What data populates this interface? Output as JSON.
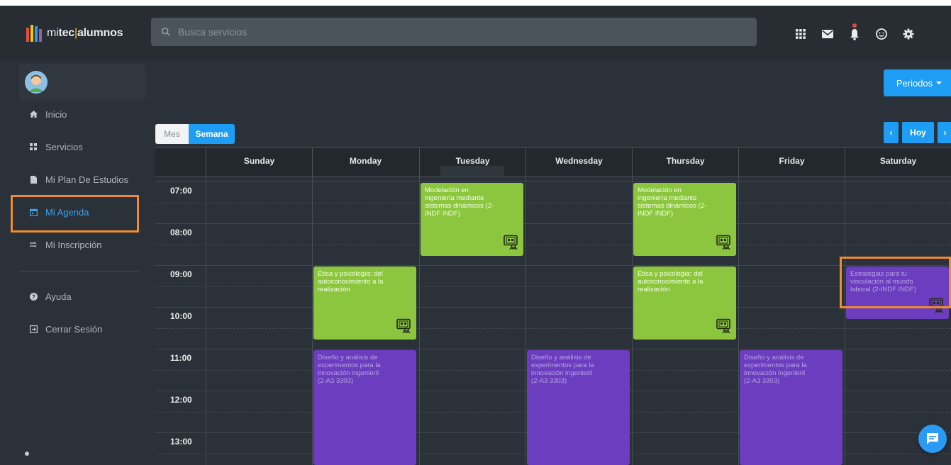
{
  "app": {
    "logo": {
      "prefix": "mi",
      "brand": "tec",
      "separator": "|",
      "suffix": "alumnos",
      "bar_colors": [
        "#e74c3c",
        "#f1c40f",
        "#3498db",
        "#9b59b6"
      ]
    },
    "search": {
      "placeholder": "Busca servicios",
      "value": ""
    },
    "top_icons": [
      "apps-grid-icon",
      "mail-icon",
      "bell-icon",
      "smiley-icon",
      "gear-icon"
    ]
  },
  "sidebar": {
    "items": [
      {
        "label": "Inicio",
        "icon": "home-icon"
      },
      {
        "label": "Servicios",
        "icon": "grid-icon"
      },
      {
        "label": "Mi Plan De Estudios",
        "icon": "document-icon"
      },
      {
        "label": "Mi Agenda",
        "icon": "calendar-icon",
        "active": true
      },
      {
        "label": "Mi Inscripción",
        "icon": "transfer-icon"
      }
    ],
    "footer_items": [
      {
        "label": "Ayuda",
        "icon": "help-icon"
      },
      {
        "label": "Cerrar Sesión",
        "icon": "logout-icon"
      }
    ]
  },
  "toolbar": {
    "periods_label": "Periodos",
    "views": {
      "month": "Mes",
      "week": "Semana",
      "selected": "week"
    },
    "nav": {
      "prev": "‹",
      "today": "Hoy",
      "next": "›"
    }
  },
  "calendar": {
    "days": [
      "Sunday",
      "Monday",
      "Tuesday",
      "Wednesday",
      "Thursday",
      "Friday",
      "Saturday"
    ],
    "times": [
      "07:00",
      "08:00",
      "09:00",
      "10:00",
      "11:00",
      "12:00",
      "13:00"
    ],
    "events": [
      {
        "day": "Tuesday",
        "start": "07:00",
        "end": "08:45",
        "color": "green",
        "title": "Modelación en ingeniería mediante sistemas dinámicos (2-INDF INDF)",
        "icon": "virtual-class-icon"
      },
      {
        "day": "Thursday",
        "start": "07:00",
        "end": "08:45",
        "color": "green",
        "title": "Modelación en ingeniería mediante sistemas dinámicos (2-INDF INDF)",
        "icon": "virtual-class-icon"
      },
      {
        "day": "Monday",
        "start": "09:00",
        "end": "10:45",
        "color": "green",
        "title": "Ética y psicología: del autoconocimiento a la realización",
        "icon": "virtual-class-icon"
      },
      {
        "day": "Thursday",
        "start": "09:00",
        "end": "10:45",
        "color": "green",
        "title": "Ética y psicología: del autoconocimiento a la realización",
        "icon": "virtual-class-icon"
      },
      {
        "day": "Saturday",
        "start": "09:00",
        "end": "10:15",
        "color": "purple",
        "title": "Estrategias para tu vinculación al mundo laboral (2-INDF INDF)",
        "icon": "virtual-class-icon"
      },
      {
        "day": "Monday",
        "start": "11:00",
        "end": "13:45",
        "color": "purple",
        "title": "Diseño y análisis de experimentos para la innovación ingenieril (2-A3 3303)"
      },
      {
        "day": "Wednesday",
        "start": "11:00",
        "end": "13:45",
        "color": "purple",
        "title": "Diseño y análisis de experimentos para la innovación ingenieril (2-A3 3303)"
      },
      {
        "day": "Friday",
        "start": "11:00",
        "end": "13:45",
        "color": "purple",
        "title": "Diseño y análisis de experimentos para la innovación ingenieril (2-A3 3303)"
      }
    ]
  },
  "colors": {
    "accent": "#1e9df5",
    "event_green": "#8cc63f",
    "event_purple": "#6c3dbe",
    "highlight_orange": "#f08a32"
  }
}
